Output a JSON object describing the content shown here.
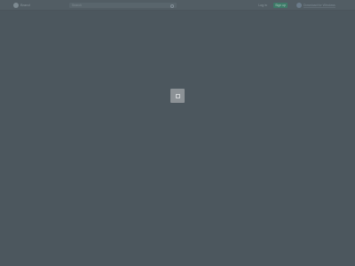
{
  "header": {
    "brand": "Brand",
    "search": {
      "placeholder": "Search"
    },
    "login_label": "Log in",
    "signup_label": "Sign up",
    "external_link": "Download for Windows"
  },
  "loading": {
    "icon": "loader-icon"
  },
  "colors": {
    "background": "#4c575e",
    "accent": "#3e7a68",
    "loader_box": "#8c9296"
  }
}
